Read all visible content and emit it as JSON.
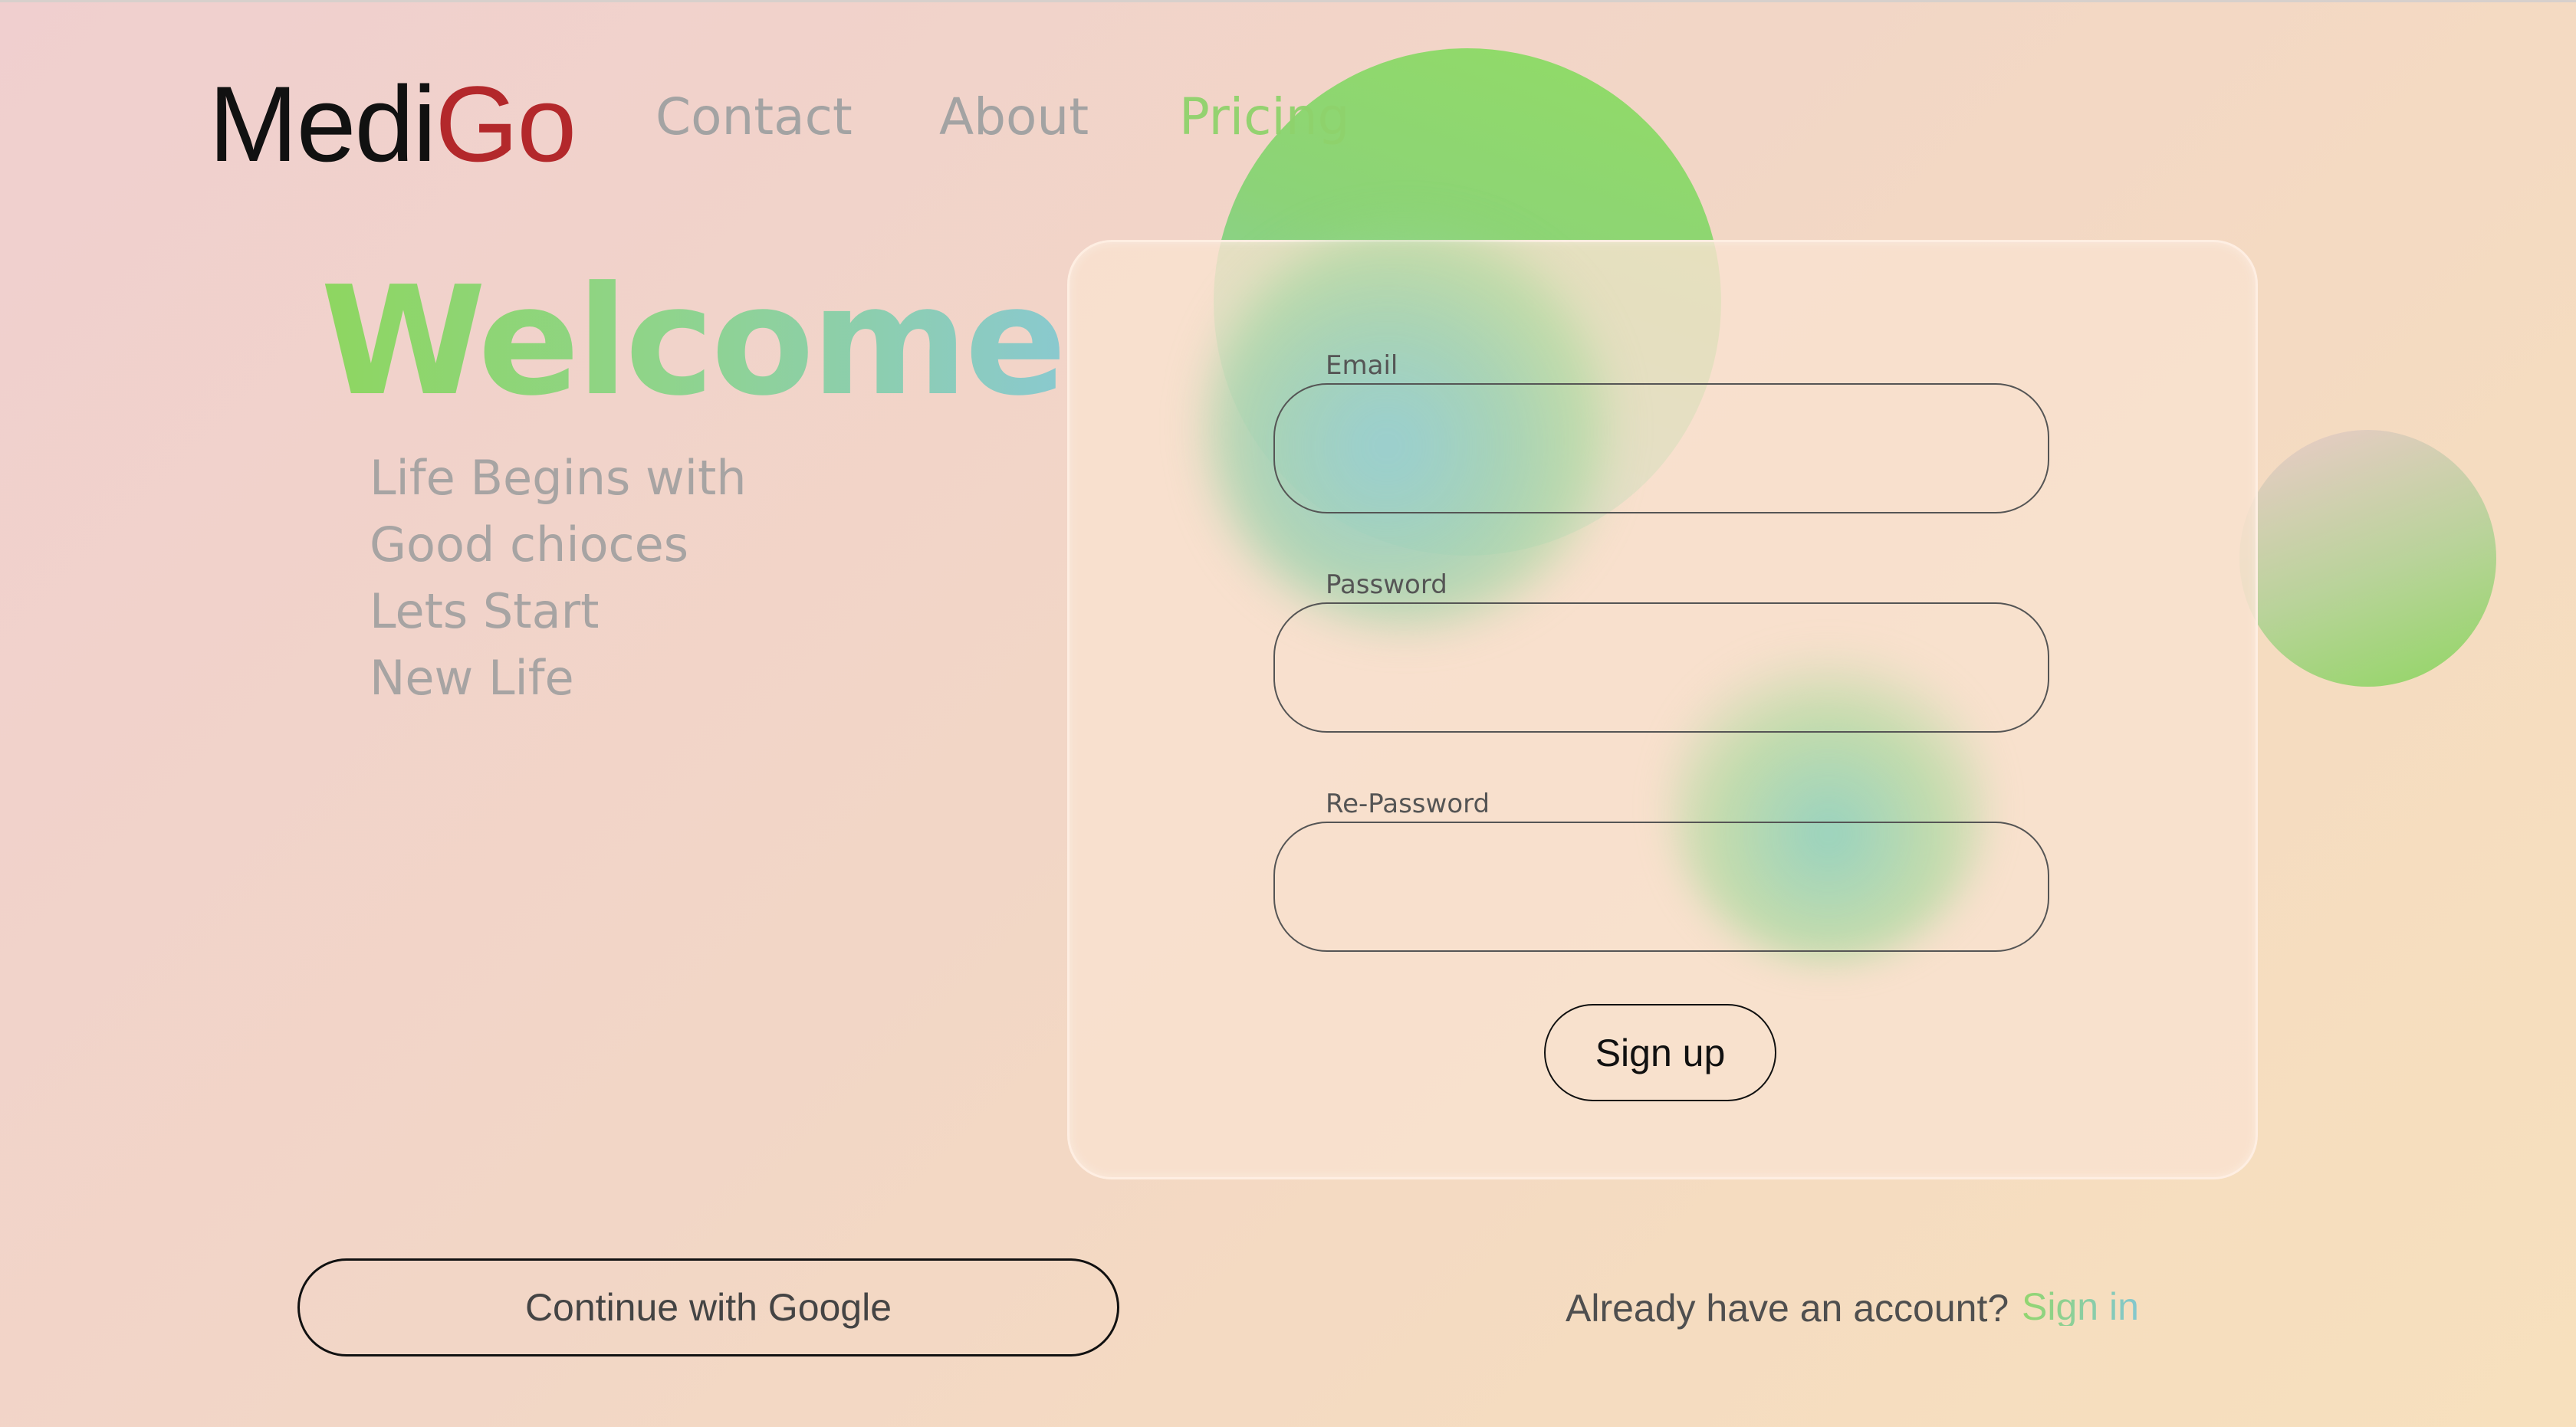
{
  "brand": {
    "logo_part1": "Medi",
    "logo_part2": "Go",
    "logo_part1_color": "#111111",
    "logo_part2_color": "#b3282b"
  },
  "nav": {
    "items": [
      {
        "label": "Contact",
        "active": false
      },
      {
        "label": "About",
        "active": false
      },
      {
        "label": "Pricing",
        "active": true,
        "color": "#8fd26c"
      }
    ]
  },
  "hero": {
    "title": "Welcome",
    "tagline": [
      "Life Begins with",
      "Good chioces",
      "Lets Start",
      "New Life"
    ]
  },
  "signup_form": {
    "email_label": "Email",
    "email_value": "",
    "password_label": "Password",
    "password_value": "",
    "repassword_label": "Re-Password",
    "repassword_value": "",
    "submit_label": "Sign up"
  },
  "footer": {
    "google_label": "Continue with Google",
    "already_text": "Already have an account?",
    "signin_label": "Sign in"
  },
  "colors": {
    "accent_green": "#8ed660",
    "accent_teal": "#8ac9cf",
    "text_muted": "#a3a3a3"
  }
}
